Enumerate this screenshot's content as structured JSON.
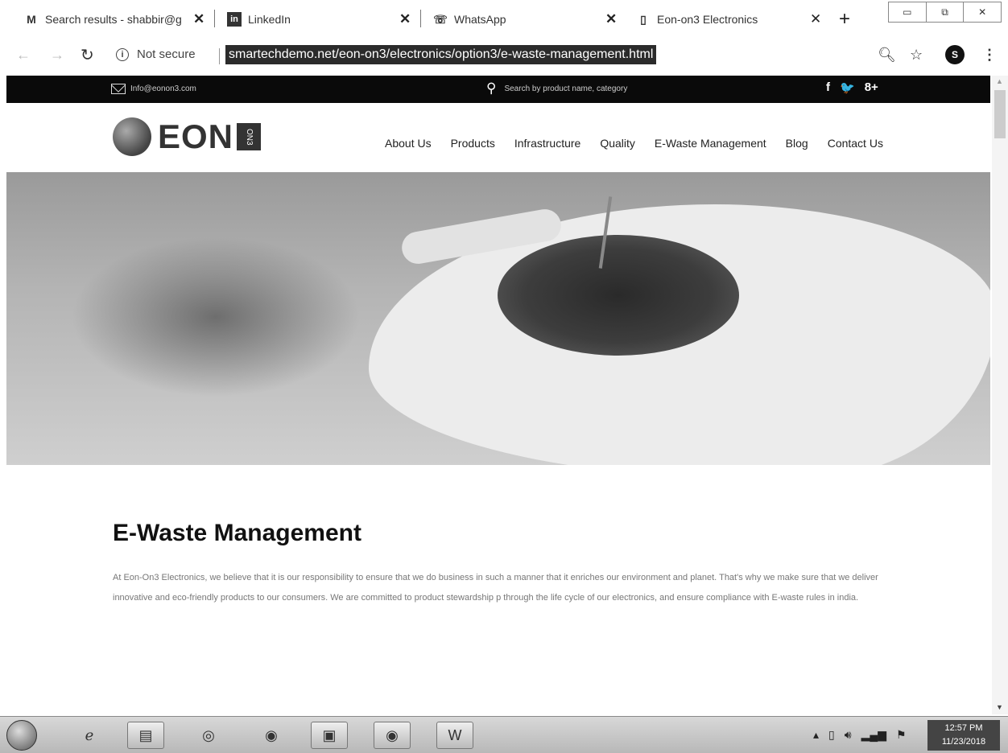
{
  "browser": {
    "tabs": [
      {
        "title": "Search results - shabbir@g",
        "icon": "M"
      },
      {
        "title": "LinkedIn",
        "icon": "in"
      },
      {
        "title": "WhatsApp",
        "icon": "☏"
      },
      {
        "title": "Eon-on3 Electronics",
        "icon": "▯"
      }
    ],
    "new_tab": "+",
    "security_label": "Not secure",
    "url": "smartechdemo.net/eon-on3/electronics/option3/e-waste-management.html",
    "avatar_letter": "S"
  },
  "site": {
    "topbar": {
      "email": "Info@eonon3.com",
      "search_placeholder": "Search by product name, category",
      "social": [
        "f",
        "🐦",
        "8+"
      ]
    },
    "logo_text": "EON",
    "logo_badge": "ON3",
    "nav": [
      "About Us",
      "Products",
      "Infrastructure",
      "Quality",
      "E-Waste Management",
      "Blog",
      "Contact Us"
    ]
  },
  "content": {
    "title": "E-Waste Management",
    "body": "At Eon-On3 Electronics, we believe that it is our responsibility to ensure that we do business in such a manner that it enriches our environment and planet. That's why we make sure that we deliver innovative and eco-friendly products to our consumers. We are committed to product stewardship p through the life cycle of our electronics, and ensure compliance with E-waste rules in india."
  },
  "taskbar": {
    "time": "12:57 PM",
    "date": "11/23/2018"
  }
}
